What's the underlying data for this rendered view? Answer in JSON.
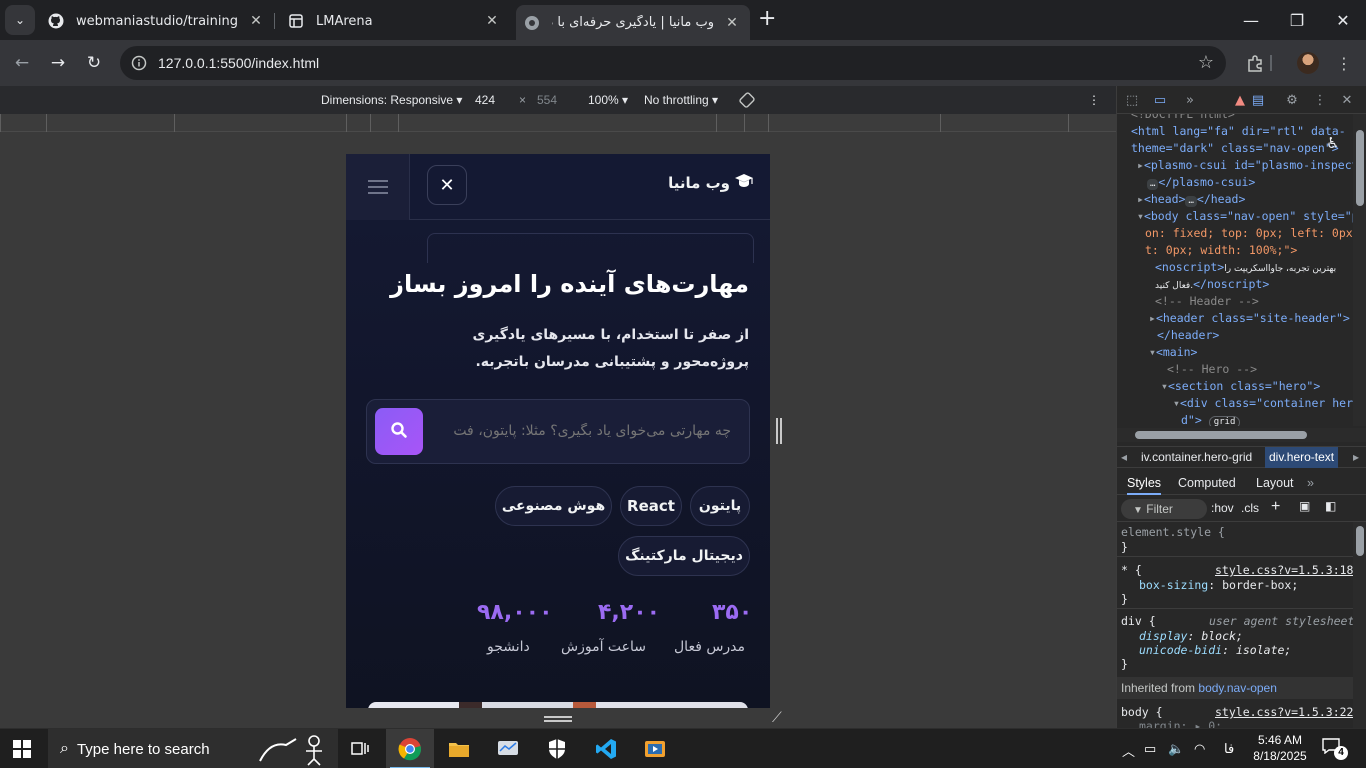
{
  "browser": {
    "tabs": [
      {
        "title": "webmaniastudio/training",
        "icon": "github-icon"
      },
      {
        "title": "LMArena",
        "icon": "grid-icon"
      },
      {
        "title": "وب مانیا | یادگیری حرفه‌ای با طعم",
        "icon": "globe-icon",
        "active": true
      }
    ],
    "new_tab_label": "+",
    "url": "127.0.0.1:5500/index.html"
  },
  "device_toolbar": {
    "dimensions_label": "Dimensions: Responsive",
    "width": "424",
    "times": "×",
    "height": "554",
    "zoom": "100%",
    "throttling": "No throttling"
  },
  "site": {
    "logo_text": "وب مانیا",
    "close_symbol": "✕",
    "hero_title": "مهارت‌های آینده را امروز بساز",
    "hero_subtitle": "از صفر تا استخدام، با مسیرهای یادگیری پروژه‌محور و پشتیبانی مدرسان باتجربه.",
    "search_placeholder": "چه مهارتی می‌خوای یاد بگیری؟ مثلا: پایتون، فت",
    "chips": [
      "پایتون",
      "React",
      "هوش مصنوعی",
      "دیجیتال مارکتینگ"
    ],
    "stats": [
      {
        "value": "۳۵۰",
        "label": "مدرس فعال"
      },
      {
        "value": "۴,۲۰۰",
        "label": "ساعت آموزش"
      },
      {
        "value": "۹۸,۰۰۰",
        "label": "دانشجو"
      }
    ],
    "accent_color": "#9b6bf2"
  },
  "devtools": {
    "dom_lines": {
      "doctype": "<!DOCTYPE html>",
      "html_open_1": "<html lang=\"fa\" dir=\"rtl\" data-",
      "html_open_2": "theme=\"dark\" class=\"nav-open\">",
      "plasmo_1": "<plasmo-csui id=\"plasmo-inspecto",
      "plasmo_2": "</plasmo-csui>",
      "head": "<head>",
      "head_close": "</head>",
      "body_1": "<body class=\"nav-open\" style=\"po",
      "body_2": "on: fixed; top: 0px; left: 0px; ",
      "body_3": "t: 0px; width: 100%;\">",
      "noscript_1": "<noscript>",
      "noscript_text_1": "بهترین تجربه، جاوااسکریپت را",
      "noscript_text_2": "فعال کنید.",
      "noscript_close": "</noscript>",
      "comment_header": "<!-- Header -->",
      "header_open": "<header class=\"site-header\">",
      "header_close": "</header>",
      "main_open": "<main>",
      "comment_hero": "<!-- Hero -->",
      "section_open": "<section class=\"hero\">",
      "div_open_1": "<div class=\"container hero",
      "div_open_2": "d\">",
      "grid_badge": "grid",
      "ellipsis": "…"
    },
    "breadcrumbs": [
      "iv.container.hero-grid",
      "div.hero-text"
    ],
    "pane_tabs": [
      "Styles",
      "Computed",
      "Layout"
    ],
    "filter_placeholder": "Filter",
    "hov": ":hov",
    "cls": ".cls",
    "styles": {
      "element_style": "element.style {",
      "close_brace": "}",
      "star_selector": "* {",
      "star_source": "style.css?v=1.5.3:18",
      "box_sizing_prop": "box-sizing",
      "box_sizing_val": "border-box;",
      "div_selector": "div {",
      "ua_label": "user agent stylesheet",
      "display_prop": "display",
      "display_val": "block;",
      "unicode_prop": "unicode-bidi",
      "unicode_val": "isolate;",
      "inherited_label": "Inherited from",
      "inherited_node": "body.nav-open",
      "body_selector": "body {",
      "body_source": "style.css?v=1.5.3:22",
      "margin_prop": "margin",
      "margin_val": "▸ 0;"
    }
  },
  "taskbar": {
    "search_placeholder": "Type here to search",
    "language": "فا",
    "time": "5:46 AM",
    "date": "8/18/2025",
    "notification_count": "4"
  }
}
